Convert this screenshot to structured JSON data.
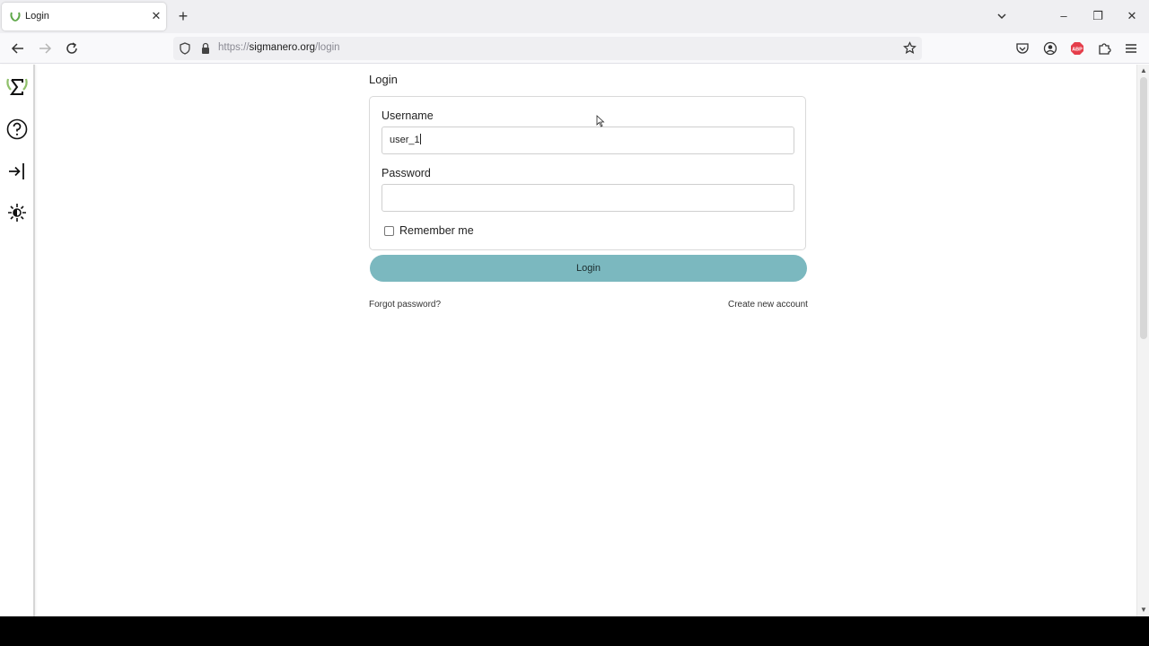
{
  "browser": {
    "tab": {
      "title": "Login",
      "close": "✕"
    },
    "new_tab": "+",
    "url": {
      "scheme": "https://",
      "host": "sigmanero.org",
      "path": "/login"
    },
    "window_controls": {
      "list_all_tabs": "⌄",
      "minimize": "–",
      "restore": "❐",
      "close": "✕"
    }
  },
  "page": {
    "title": "Login",
    "username": {
      "label": "Username",
      "value": "user_1"
    },
    "password": {
      "label": "Password",
      "value": ""
    },
    "remember_me": {
      "label": "Remember me",
      "checked": false
    },
    "login_button": "Login",
    "forgot_password": "Forgot password?",
    "create_account": "Create new account"
  },
  "colors": {
    "login_button": "#7bb8bf",
    "abp_badge": "#e53e4b",
    "favicon": "#5fa84a"
  },
  "sidebar": {
    "items": [
      "sigma-logo-icon",
      "help-icon",
      "sign-in-icon",
      "theme-toggle-icon"
    ]
  }
}
